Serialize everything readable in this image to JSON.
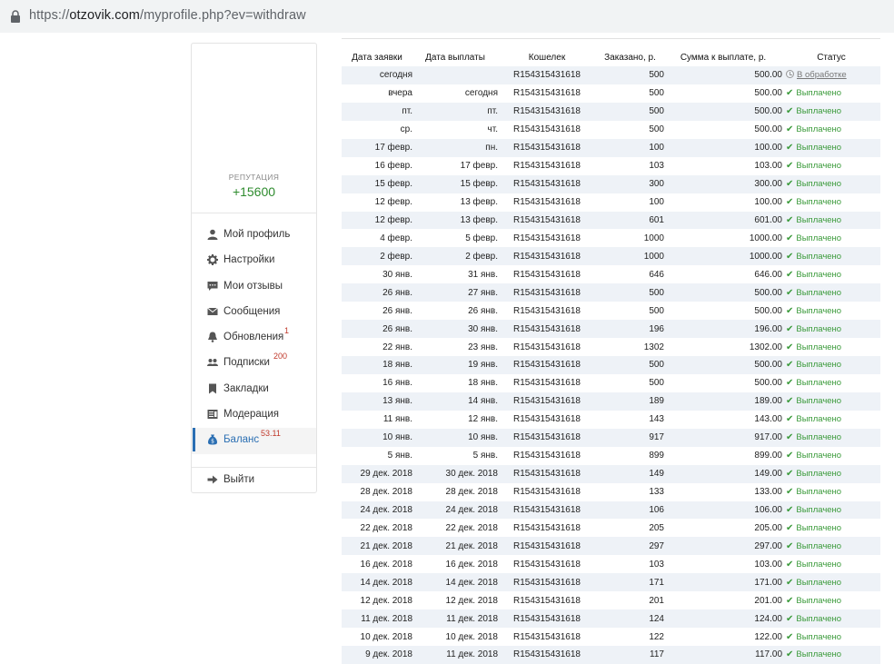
{
  "address": {
    "scheme": "https://",
    "host": "otzovik.com",
    "path": "/myprofile.php?ev=withdraw"
  },
  "profile": {
    "reputation_label": "РЕПУТАЦИЯ",
    "reputation_value": "+15600"
  },
  "menu": {
    "items": [
      {
        "label": "Мой профиль",
        "icon": "user-icon",
        "count": ""
      },
      {
        "label": "Настройки",
        "icon": "gear-icon",
        "count": ""
      },
      {
        "label": "Мои отзывы",
        "icon": "comment-icon",
        "count": ""
      },
      {
        "label": "Сообщения",
        "icon": "envelope-icon",
        "count": ""
      },
      {
        "label": "Обновления",
        "icon": "bell-icon",
        "count": "1"
      },
      {
        "label": "Подписки",
        "icon": "users-icon",
        "count": "200"
      },
      {
        "label": "Закладки",
        "icon": "bookmark-icon",
        "count": ""
      },
      {
        "label": "Модерация",
        "icon": "moderation-icon",
        "count": ""
      },
      {
        "label": "Баланс",
        "icon": "money-bag-icon",
        "count": "53.11"
      }
    ],
    "logout": "Выйти"
  },
  "table": {
    "headers": [
      "Дата заявки",
      "Дата выплаты",
      "Кошелек",
      "Заказано, р.",
      "Сумма к выплате, р.",
      "Статус"
    ],
    "rows": [
      [
        "сегодня",
        "",
        "R154315431618",
        "500",
        "500.00",
        "В обработке"
      ],
      [
        "вчера",
        "сегодня",
        "R154315431618",
        "500",
        "500.00",
        "Выплачено"
      ],
      [
        "пт.",
        "пт.",
        "R154315431618",
        "500",
        "500.00",
        "Выплачено"
      ],
      [
        "ср.",
        "чт.",
        "R154315431618",
        "500",
        "500.00",
        "Выплачено"
      ],
      [
        "17 февр.",
        "пн.",
        "R154315431618",
        "100",
        "100.00",
        "Выплачено"
      ],
      [
        "16 февр.",
        "17 февр.",
        "R154315431618",
        "103",
        "103.00",
        "Выплачено"
      ],
      [
        "15 февр.",
        "15 февр.",
        "R154315431618",
        "300",
        "300.00",
        "Выплачено"
      ],
      [
        "12 февр.",
        "13 февр.",
        "R154315431618",
        "100",
        "100.00",
        "Выплачено"
      ],
      [
        "12 февр.",
        "13 февр.",
        "R154315431618",
        "601",
        "601.00",
        "Выплачено"
      ],
      [
        "4 февр.",
        "5 февр.",
        "R154315431618",
        "1000",
        "1000.00",
        "Выплачено"
      ],
      [
        "2 февр.",
        "2 февр.",
        "R154315431618",
        "1000",
        "1000.00",
        "Выплачено"
      ],
      [
        "30 янв.",
        "31 янв.",
        "R154315431618",
        "646",
        "646.00",
        "Выплачено"
      ],
      [
        "26 янв.",
        "27 янв.",
        "R154315431618",
        "500",
        "500.00",
        "Выплачено"
      ],
      [
        "26 янв.",
        "26 янв.",
        "R154315431618",
        "500",
        "500.00",
        "Выплачено"
      ],
      [
        "26 янв.",
        "30 янв.",
        "R154315431618",
        "196",
        "196.00",
        "Выплачено"
      ],
      [
        "22 янв.",
        "23 янв.",
        "R154315431618",
        "1302",
        "1302.00",
        "Выплачено"
      ],
      [
        "18 янв.",
        "19 янв.",
        "R154315431618",
        "500",
        "500.00",
        "Выплачено"
      ],
      [
        "16 янв.",
        "18 янв.",
        "R154315431618",
        "500",
        "500.00",
        "Выплачено"
      ],
      [
        "13 янв.",
        "14 янв.",
        "R154315431618",
        "189",
        "189.00",
        "Выплачено"
      ],
      [
        "11 янв.",
        "12 янв.",
        "R154315431618",
        "143",
        "143.00",
        "Выплачено"
      ],
      [
        "10 янв.",
        "10 янв.",
        "R154315431618",
        "917",
        "917.00",
        "Выплачено"
      ],
      [
        "5 янв.",
        "5 янв.",
        "R154315431618",
        "899",
        "899.00",
        "Выплачено"
      ],
      [
        "29 дек. 2018",
        "30 дек. 2018",
        "R154315431618",
        "149",
        "149.00",
        "Выплачено"
      ],
      [
        "28 дек. 2018",
        "28 дек. 2018",
        "R154315431618",
        "133",
        "133.00",
        "Выплачено"
      ],
      [
        "24 дек. 2018",
        "24 дек. 2018",
        "R154315431618",
        "106",
        "106.00",
        "Выплачено"
      ],
      [
        "22 дек. 2018",
        "22 дек. 2018",
        "R154315431618",
        "205",
        "205.00",
        "Выплачено"
      ],
      [
        "21 дек. 2018",
        "21 дек. 2018",
        "R154315431618",
        "297",
        "297.00",
        "Выплачено"
      ],
      [
        "16 дек. 2018",
        "16 дек. 2018",
        "R154315431618",
        "103",
        "103.00",
        "Выплачено"
      ],
      [
        "14 дек. 2018",
        "14 дек. 2018",
        "R154315431618",
        "171",
        "171.00",
        "Выплачено"
      ],
      [
        "12 дек. 2018",
        "12 дек. 2018",
        "R154315431618",
        "201",
        "201.00",
        "Выплачено"
      ],
      [
        "11 дек. 2018",
        "11 дек. 2018",
        "R154315431618",
        "124",
        "124.00",
        "Выплачено"
      ],
      [
        "10 дек. 2018",
        "10 дек. 2018",
        "R154315431618",
        "122",
        "122.00",
        "Выплачено"
      ],
      [
        "9 дек. 2018",
        "11 дек. 2018",
        "R154315431618",
        "117",
        "117.00",
        "Выплачено"
      ]
    ]
  }
}
